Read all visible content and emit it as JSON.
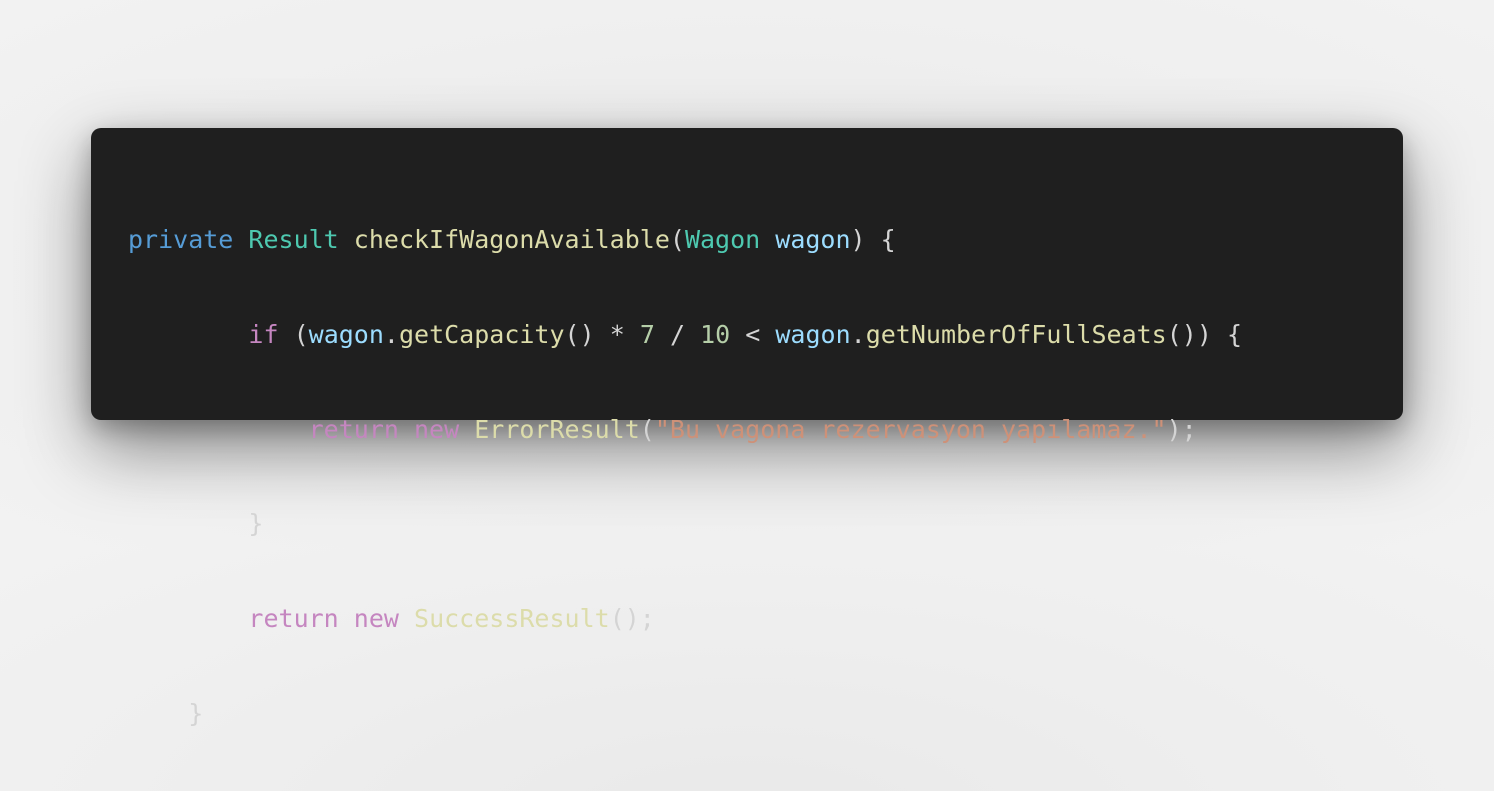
{
  "colors": {
    "background": "#efefef",
    "editor_background": "#1f1f1f",
    "default_text": "#d4d4d4",
    "keyword": "#569cd6",
    "type": "#4ec9b0",
    "function": "#dcdcaa",
    "variable": "#9cdcfe",
    "control": "#c586c0",
    "number": "#b5cea8",
    "string": "#ce9178"
  },
  "code": {
    "line1": {
      "modifier": "private",
      "return_type": "Result",
      "method": "checkIfWagonAvailable",
      "open_paren": "(",
      "param_type": "Wagon",
      "param_name": "wagon",
      "close": ") {"
    },
    "line2": {
      "indent": "        ",
      "keyword": "if",
      "open": " (",
      "var1": "wagon",
      "dot1": ".",
      "call1": "getCapacity",
      "parens1": "() ",
      "op1": "*",
      "num1": "7",
      "op2": "/",
      "num2": "10",
      "op3": "<",
      "var2": "wagon",
      "dot2": ".",
      "call2": "getNumberOfFullSeats",
      "close": "()) {"
    },
    "line3": {
      "indent": "            ",
      "keyword1": "return",
      "keyword2": "new",
      "class": "ErrorResult",
      "open": "(",
      "string": "\"Bu vagona rezervasyon yapılamaz.\"",
      "close": ");"
    },
    "line4": {
      "indent": "        ",
      "brace": "}"
    },
    "line5": {
      "indent": "        ",
      "keyword1": "return",
      "keyword2": "new",
      "class": "SuccessResult",
      "close": "();"
    },
    "line6": {
      "indent": "    ",
      "brace": "}"
    }
  }
}
